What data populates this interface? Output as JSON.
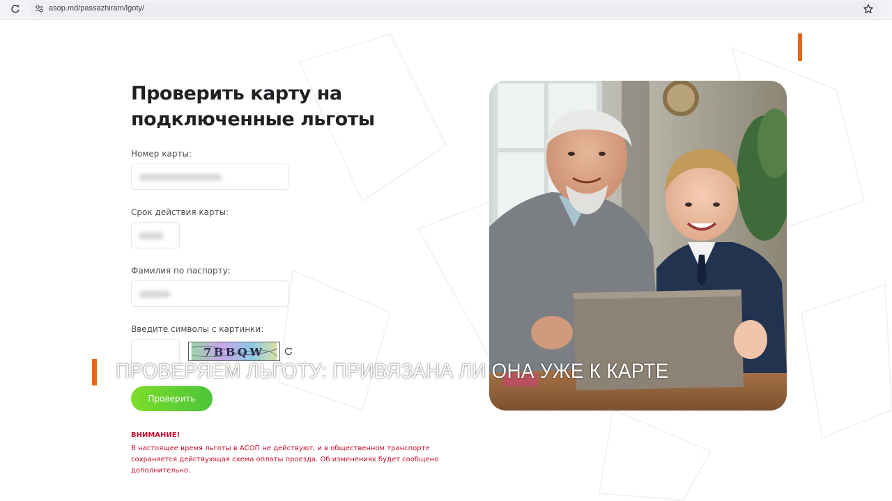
{
  "browser": {
    "url": "asop.md/passazhiram/lgoty/",
    "icons": [
      "reload-icon",
      "site-settings-icon",
      "bookmark-star-icon"
    ]
  },
  "form": {
    "title": "Проверить карту на подключенные льготы",
    "card_number_label": "Номер карты:",
    "expiry_label": "Срок действия карты:",
    "surname_label": "Фамилия по паспорту:",
    "captcha_label": "Введите символы с картинки:",
    "captcha_text": "7BBQW",
    "submit_label": "Проверить"
  },
  "warning": {
    "title": "ВНИМАНИЕ!",
    "text": "В настоящее время льготы в АСОП не действуют, и в общественном транспорте сохраняется действующая схема оплаты проезда. Об изменениях будет сообщено дополнительно."
  },
  "caption": {
    "text": "ПРОВЕРЯЕМ ЛЬГОТУ: ПРИВЯЗАНА ЛИ ОНА УЖЕ К КАРТЕ"
  },
  "colors": {
    "accent": "#e8681a",
    "button": "#5fd034",
    "warning": "#c8102e"
  }
}
